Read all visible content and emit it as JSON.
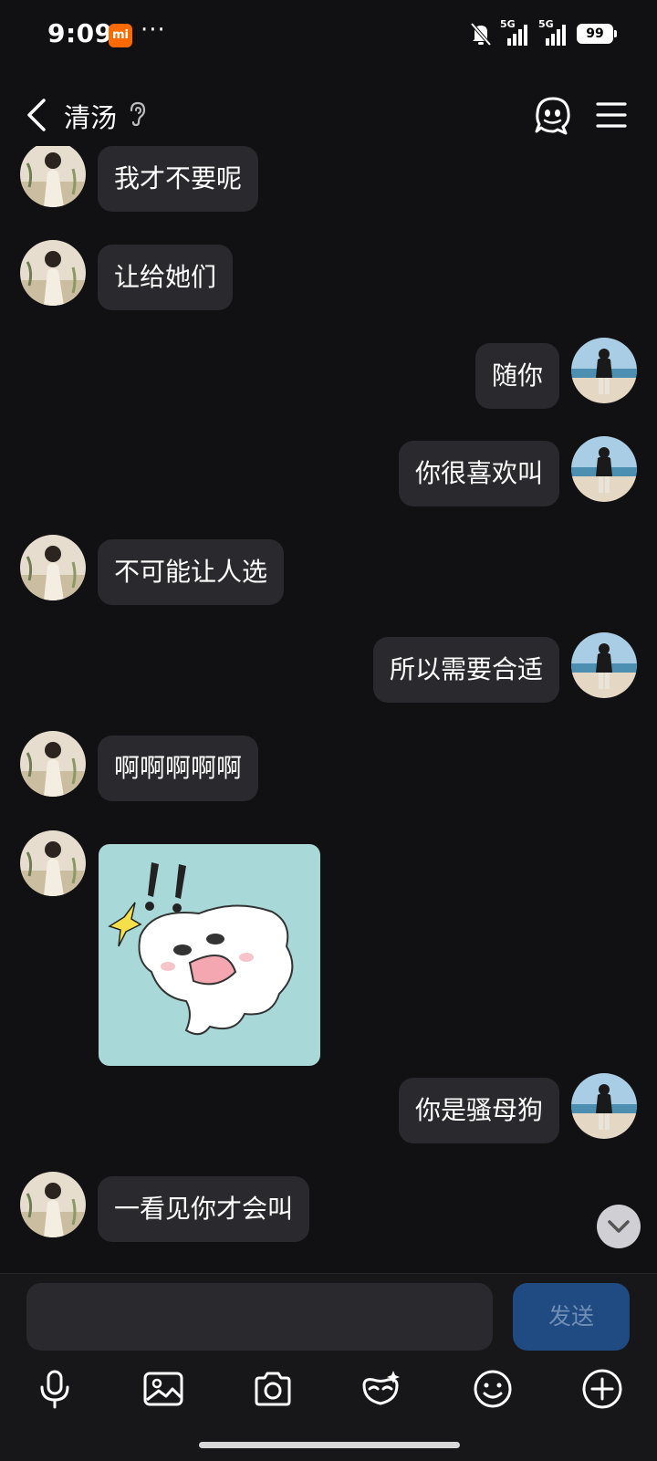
{
  "status_bar": {
    "time": "9:09",
    "mi_badge": "mi",
    "more": "···",
    "signal1_label": "5G",
    "signal2_label": "5G",
    "battery": "99"
  },
  "header": {
    "title": "清汤",
    "icons": [
      "back-icon",
      "ear-icon",
      "mascot-icon",
      "menu-icon"
    ]
  },
  "messages": [
    {
      "side": "left",
      "text": "我才不要呢"
    },
    {
      "side": "left",
      "text": "让给她们"
    },
    {
      "side": "right",
      "text": "随你"
    },
    {
      "side": "right",
      "text": "你很喜欢叫"
    },
    {
      "side": "left",
      "text": "不可能让人选"
    },
    {
      "side": "right",
      "text": "所以需要合适"
    },
    {
      "side": "left",
      "text": "啊啊啊啊啊"
    },
    {
      "side": "left",
      "type": "sticker",
      "text": ""
    },
    {
      "side": "right",
      "text": "你是骚母狗"
    },
    {
      "side": "left",
      "text": "一看见你才会叫"
    }
  ],
  "input": {
    "value": "",
    "placeholder": "",
    "send_label": "发送"
  },
  "toolbar": [
    "microphone-icon",
    "image-icon",
    "camera-icon",
    "mask-icon",
    "emoji-icon",
    "plus-icon"
  ],
  "colors": {
    "background": "#111113",
    "bubble": "#2a2a2e",
    "send_button": "#1f4a82",
    "sticker_bg": "#a8d8d8"
  }
}
